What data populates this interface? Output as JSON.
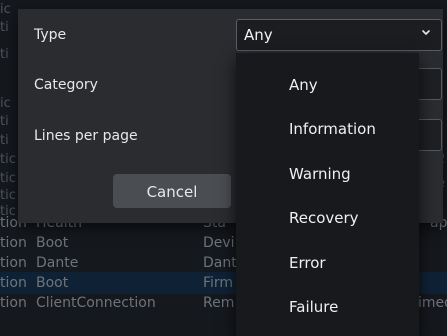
{
  "background_table": {
    "rows": [
      {
        "c0": "tion",
        "c1": "Health",
        "c2": "Sta",
        "c3": "ap"
      },
      {
        "c0": "tion",
        "c1": "Boot",
        "c2": "Devi",
        "c3": ""
      },
      {
        "c0": "tion",
        "c1": "Dante",
        "c2": "Dant",
        "c3": ""
      },
      {
        "c0": "tion",
        "c1": "Boot",
        "c2": "Firm",
        "c3": ""
      },
      {
        "c0": "tion",
        "c1": "ClientConnection",
        "c2": "Rem",
        "c3": "imed"
      }
    ],
    "side_fragments": [
      "ic",
      "ti",
      "ti",
      "ic",
      "ti",
      "ti",
      "tic",
      "tic",
      "tic",
      "tic"
    ],
    "right_fragments": [
      "2",
      "e"
    ]
  },
  "dialog": {
    "type_label": "Type",
    "type_value": "Any",
    "category_label": "Category",
    "lines_label": "Lines per page",
    "cancel_label": "Cancel"
  },
  "menu": {
    "items": [
      "Any",
      "Information",
      "Warning",
      "Recovery",
      "Error",
      "Failure"
    ]
  },
  "colors": {
    "dialog_bg": "#2a2c30",
    "menu_bg": "#17191c",
    "selected_row": "#0f2235",
    "accent": "#2e6fbf"
  },
  "icons": {
    "select_chevron": "chevron-down-icon"
  }
}
